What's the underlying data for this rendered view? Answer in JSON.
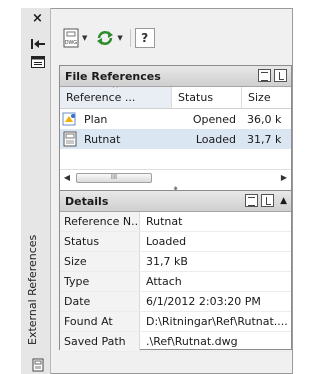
{
  "palette": {
    "title": "External References",
    "close_glyph": "×"
  },
  "toolbar": {
    "attach_icon_text": "DWG",
    "help_glyph": "?"
  },
  "file_refs": {
    "title": "File References",
    "columns": [
      "Reference ...",
      "Status",
      "Size"
    ],
    "rows": [
      {
        "name": "Plan",
        "status": "Opened",
        "size": "36,0 k"
      },
      {
        "name": "Rutnat",
        "status": "Loaded",
        "size": "31,7 k"
      }
    ],
    "scroll_thumb_text": "III"
  },
  "details": {
    "title": "Details",
    "rows": [
      {
        "label": "Reference N...",
        "value": "Rutnat"
      },
      {
        "label": "Status",
        "value": "Loaded"
      },
      {
        "label": "Size",
        "value": "31,7 kB"
      },
      {
        "label": "Type",
        "value": "Attach"
      },
      {
        "label": "Date",
        "value": "6/1/2012 2:03:20 PM"
      },
      {
        "label": "Found At",
        "value": "D:\\Ritningar\\Ref\\Rutnat...."
      },
      {
        "label": "Saved Path",
        "value": ".\\Ref\\Rutnat.dwg"
      }
    ]
  }
}
